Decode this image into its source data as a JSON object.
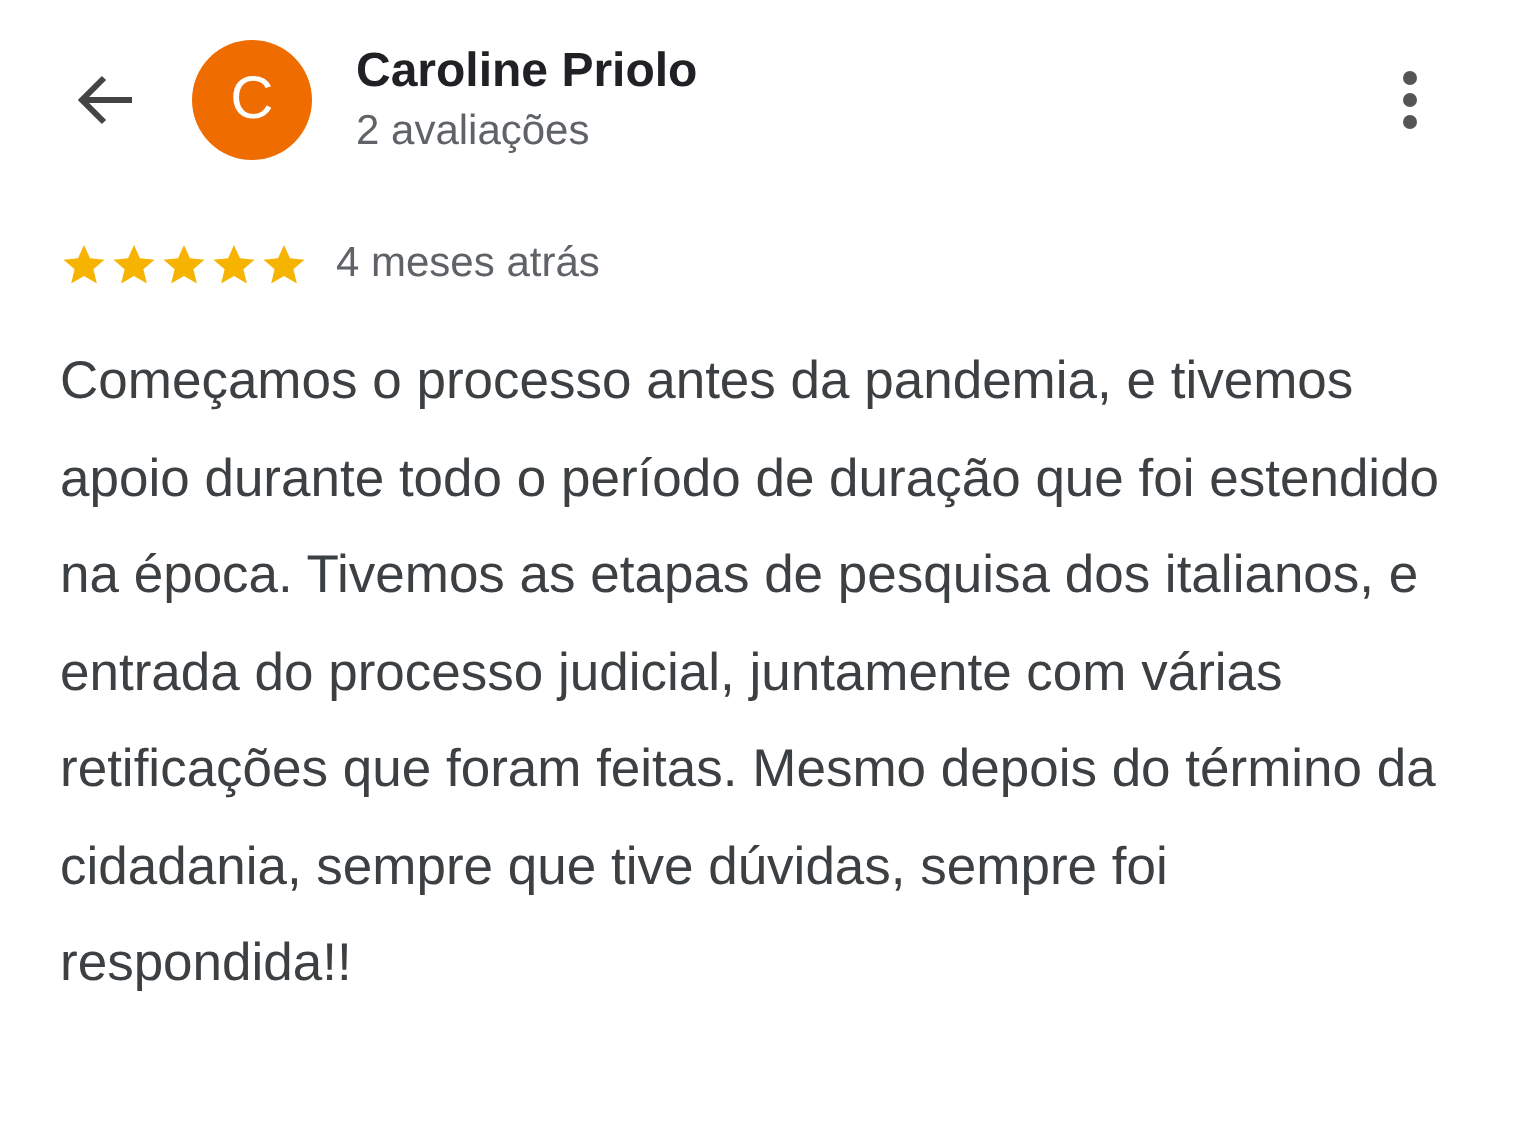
{
  "reviewer": {
    "initial": "C",
    "name": "Caroline Priolo",
    "review_count": "2 avaliações"
  },
  "review": {
    "stars": 5,
    "time": "4 meses atrás",
    "text": "Começamos o processo antes da pandemia, e tivemos apoio durante todo o período de duração que foi estendido na época. Tivemos as etapas de pesquisa dos italianos, e entrada do processo judicial, juntamente com várias retificações que foram feitas. Mesmo depois do término da cidadania, sempre que tive dúvidas, sempre foi respondida!!"
  }
}
